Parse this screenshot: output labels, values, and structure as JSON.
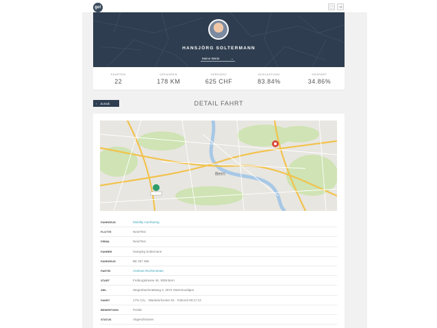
{
  "app": {
    "logo_text": "go!",
    "top_buttons": [
      "⬚",
      "⇥"
    ]
  },
  "profile": {
    "name": "HANSJÖRG SOLTERMANN",
    "selector_label": "Meine Werte",
    "selector_chevron": "→"
  },
  "stats": [
    {
      "label": "Fahrten",
      "value": "22"
    },
    {
      "label": "Gefahren",
      "value": "178 KM"
    },
    {
      "label": "Verdient",
      "value": "625 CHF"
    },
    {
      "label": "Auslastung",
      "value": "83.84%"
    },
    {
      "label": "Gespart",
      "value": "34.86%"
    }
  ],
  "nav": {
    "back_icon": "‹",
    "back_label": "Zurück",
    "page_title": "DETAIL FAHRT"
  },
  "map": {
    "city_label": "Bern",
    "colors": {
      "land": "#e8e6e1",
      "green": "#cfe3b4",
      "water": "#a8c8e6",
      "road": "#f2c24a",
      "start_pin": "#2e9c6a",
      "end_pin": "#d9483b"
    }
  },
  "details": [
    {
      "key": "Fahrzeug",
      "value": "Mobility Carsharing",
      "link": true
    },
    {
      "key": "Flotte",
      "value": "Nein/Test",
      "link": false
    },
    {
      "key": "Firma",
      "value": "Nein/Test",
      "link": false
    },
    {
      "key": "Fahrer",
      "value": "Hansjörg Soltermann",
      "link": false
    },
    {
      "key": "Fahrzeug",
      "value": "BE 257 386",
      "link": false
    },
    {
      "key": "Partei",
      "value": "Andreas Rechts Beats",
      "link": true
    },
    {
      "key": "Start",
      "value": "Freiburgstrasse 45, 3008 Bern",
      "link": false
    },
    {
      "key": "Ziel",
      "value": "Stegenbachmattweg 2, 3072 Ostermundigen",
      "link": false
    },
    {
      "key": "Fahrt",
      "value": "17% CO₂ · Wankdorfcenter 81 · Fahrzeit 00:17:13",
      "link": false
    },
    {
      "key": "Bewertung",
      "value": "Positiv",
      "link": false
    },
    {
      "key": "Status",
      "value": "Abgeschlossen",
      "link": false
    }
  ]
}
